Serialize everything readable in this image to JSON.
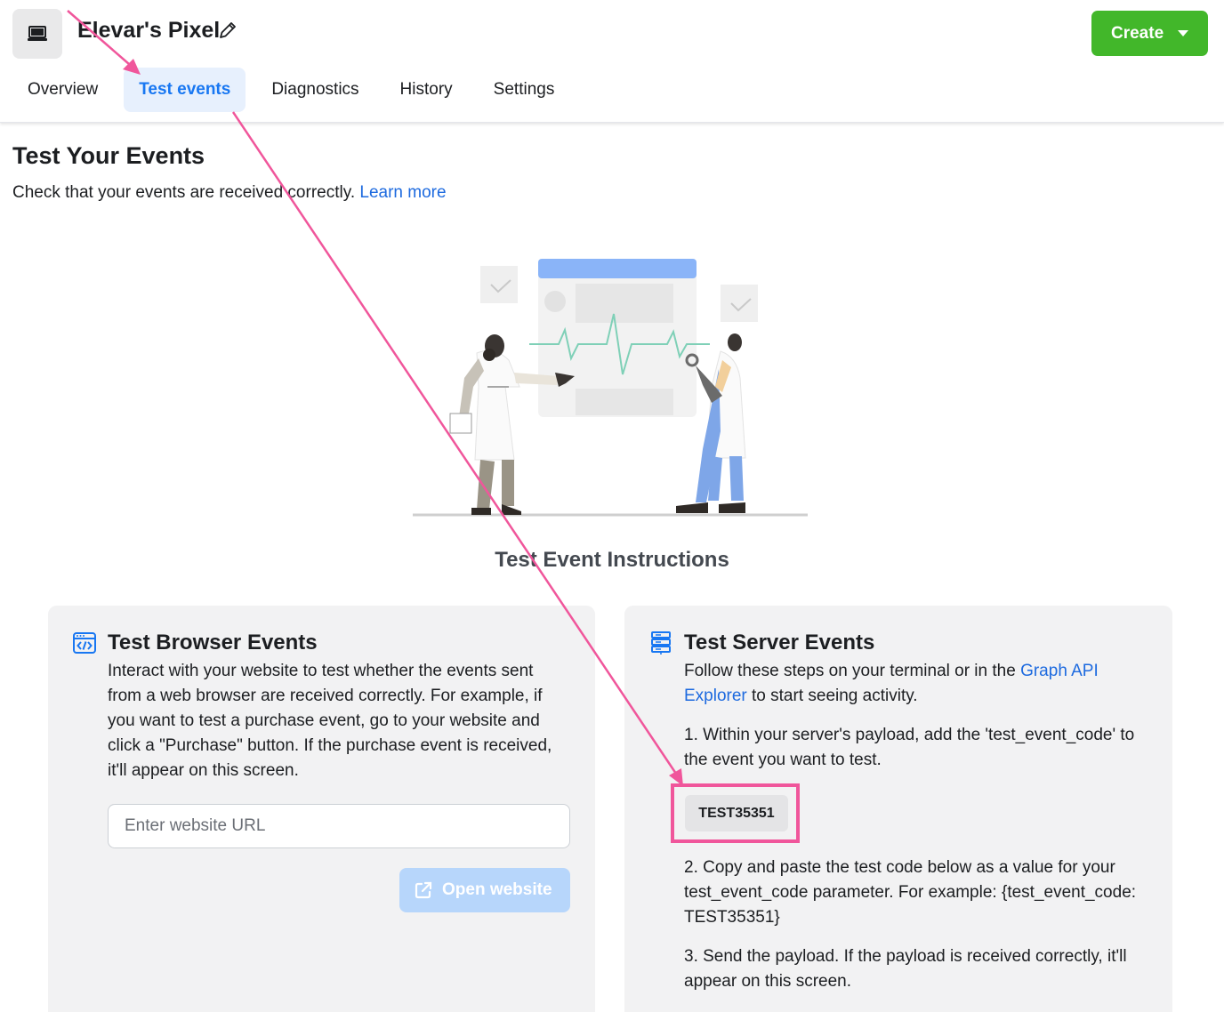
{
  "header": {
    "pixel_name": "Elevar's Pixel",
    "create_label": "Create",
    "tabs": [
      {
        "label": "Overview",
        "active": false
      },
      {
        "label": "Test events",
        "active": true
      },
      {
        "label": "Diagnostics",
        "active": false
      },
      {
        "label": "History",
        "active": false
      },
      {
        "label": "Settings",
        "active": false
      }
    ],
    "accent_color": "#1877f2",
    "create_color": "#42b72a"
  },
  "main": {
    "title": "Test Your Events",
    "subtitle": "Check that your events are received correctly.",
    "learn_more": "Learn more",
    "instructions_title": "Test Event Instructions"
  },
  "browser_card": {
    "icon": "code-window-icon",
    "title": "Test Browser Events",
    "body": "Interact with your website to test whether the events sent from a web browser are received correctly. For example, if you want to test a purchase event, go to your website and click a \"Purchase\" button. If the purchase event is received, it'll appear on this screen.",
    "url_placeholder": "Enter website URL",
    "open_button": "Open website"
  },
  "server_card": {
    "icon": "server-icon",
    "title": "Test Server Events",
    "intro_before": "Follow these steps on your terminal or in the",
    "intro_link": "Graph API Explorer",
    "intro_after": "to start seeing activity.",
    "step1": "1. Within your server's payload, add the 'test_event_code' to the event you want to test.",
    "test_code": "TEST35351",
    "step2": "2. Copy and paste the test code below as a value for your test_event_code parameter. For example: {test_event_code: TEST35351}",
    "step3": "3. Send the payload. If the payload is received correctly, it'll appear on this screen."
  },
  "annotation": {
    "highlight_color": "#f0569b"
  }
}
